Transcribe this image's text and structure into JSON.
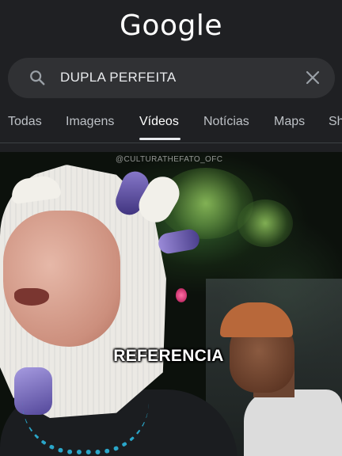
{
  "header": {
    "logo_text": "Google"
  },
  "search": {
    "query": "DUPLA PERFEITA",
    "icon": "search-icon",
    "clear_icon": "close-icon"
  },
  "tabs": [
    {
      "label": "Todas",
      "active": false
    },
    {
      "label": "Imagens",
      "active": false
    },
    {
      "label": "Vídeos",
      "active": true
    },
    {
      "label": "Notícias",
      "active": false
    },
    {
      "label": "Maps",
      "active": false
    },
    {
      "label": "Sh",
      "active": false
    }
  ],
  "video": {
    "watermark": "@CULTURATHEFATO_OFC",
    "caption": "REFERENCIA"
  },
  "colors": {
    "background": "#202124",
    "search_bg": "#303134",
    "tab_text": "#bdc1c6",
    "tab_active": "#ffffff"
  }
}
